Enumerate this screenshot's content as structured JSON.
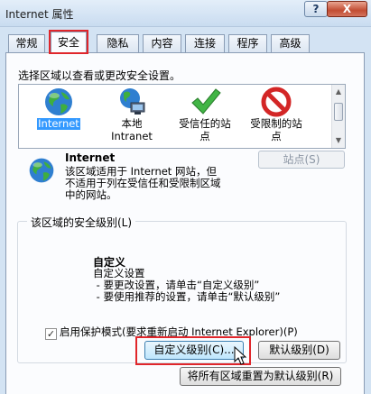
{
  "window": {
    "title": "Internet 属性",
    "help_label": "?",
    "close_label": "X"
  },
  "tabs": [
    {
      "label": "常规",
      "active": false
    },
    {
      "label": "安全",
      "active": true
    },
    {
      "label": "隐私",
      "active": false
    },
    {
      "label": "内容",
      "active": false
    },
    {
      "label": "连接",
      "active": false
    },
    {
      "label": "程序",
      "active": false
    },
    {
      "label": "高级",
      "active": false
    }
  ],
  "security": {
    "select_label": "选择区域以查看或更改安全设置。",
    "zones": [
      {
        "label_lines": [
          "Internet"
        ],
        "icon": "globe-icon",
        "selected": true
      },
      {
        "label_lines": [
          "本地",
          "Intranet"
        ],
        "icon": "local-intranet-icon",
        "selected": false
      },
      {
        "label_lines": [
          "受信任的站",
          "点"
        ],
        "icon": "check-icon",
        "selected": false
      },
      {
        "label_lines": [
          "受限制的站",
          "点"
        ],
        "icon": "no-entry-icon",
        "selected": false
      }
    ],
    "selected_zone": {
      "title": "Internet",
      "description_lines": [
        "该区域适用于 Internet 网站，但",
        "不适用于列在受信任和受限制区域",
        "中的网站。"
      ],
      "sites_button": "站点(S)"
    },
    "level_group": {
      "label": "该区域的安全级别(L)",
      "custom_title": "自定义",
      "custom_lines": [
        "自定义设置",
        " - 要更改设置，请单击“自定义级别”",
        " - 要使用推荐的设置，请单击“默认级别”"
      ],
      "protected_mode": {
        "label": "启用保护模式(要求重新启动 Internet Explorer)(P)",
        "checked": true
      },
      "custom_level_button": "自定义级别(C)...",
      "default_level_button": "默认级别(D)"
    },
    "reset_all_button": "将所有区域重置为默认级别(R)"
  },
  "colors": {
    "selection": "#3399ff",
    "highlight_box": "#e0262b"
  }
}
